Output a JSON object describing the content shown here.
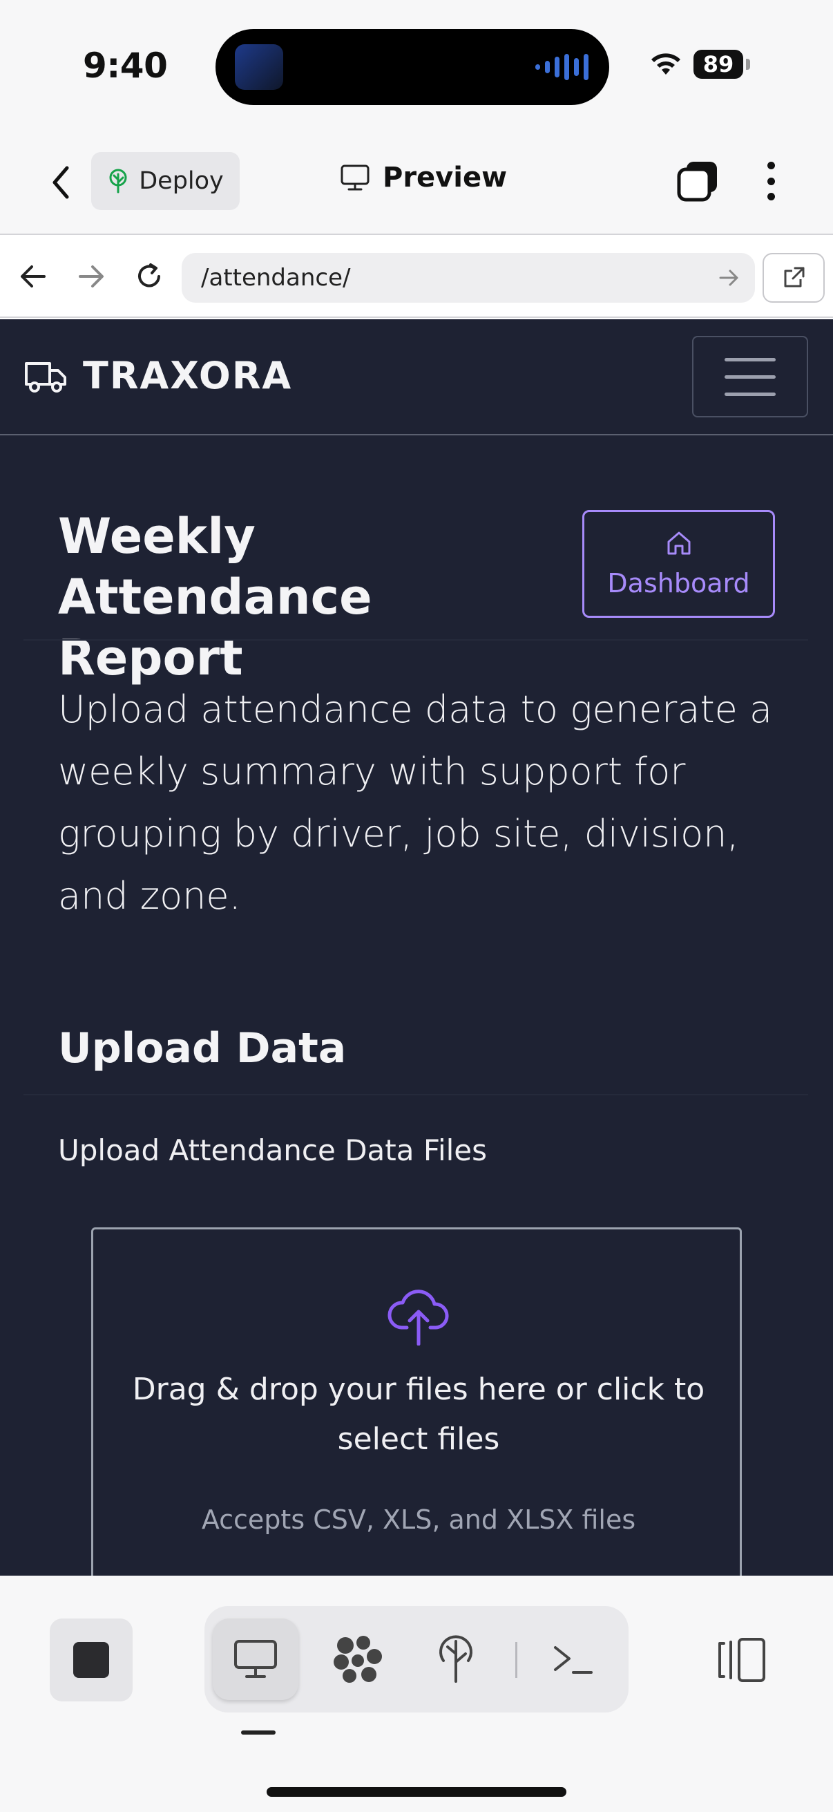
{
  "status_bar": {
    "time": "9:40",
    "battery": "89"
  },
  "app_bar": {
    "deploy_label": "Deploy",
    "title": "Preview"
  },
  "browser": {
    "url": "/attendance/"
  },
  "site": {
    "brand": "TRAXORA",
    "page_title": "Weekly Attendance Report",
    "dashboard_label": "Dashboard",
    "lead": "Upload attendance data to generate a weekly summary with support for grouping by driver, job site, division, and zone.",
    "section_title": "Upload Data",
    "field_label": "Upload Attendance Data Files",
    "drop_text": "Drag & drop your files here or click to select files",
    "drop_hint": "Accepts CSV, XLS, and XLSX files"
  },
  "colors": {
    "accent": "#a78bfa",
    "content_bg": "#1e2233",
    "toolbar_bg": "#f7f7f8"
  },
  "icons": {
    "app_bar": [
      "back-chevron-icon",
      "tree-icon",
      "monitor-icon",
      "tabs-icon",
      "more-vertical-icon"
    ],
    "browser": [
      "arrow-left-icon",
      "arrow-right-icon",
      "reload-icon",
      "arrow-go-icon",
      "external-link-icon"
    ],
    "site": [
      "truck-icon",
      "hamburger-icon",
      "home-icon",
      "cloud-upload-icon"
    ],
    "toolbar": [
      "stop-icon",
      "monitor-icon",
      "nodes-icon",
      "deploy-tree-icon",
      "terminal-icon",
      "panel-icon"
    ]
  }
}
